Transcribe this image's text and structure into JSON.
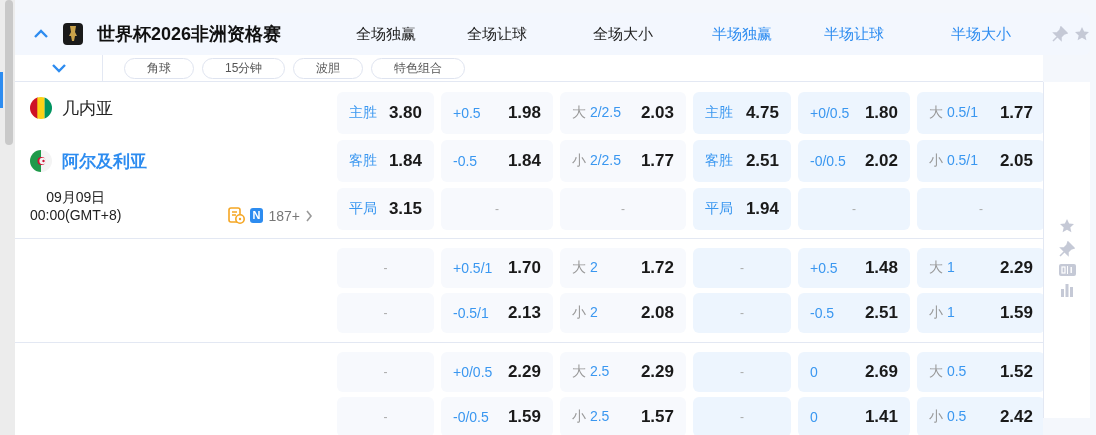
{
  "header": {
    "title": "世界杯2026非洲资格赛",
    "expanded": true,
    "columns": [
      {
        "label": "全场独赢",
        "half": false
      },
      {
        "label": "全场让球",
        "half": false
      },
      {
        "label": "全场大小",
        "half": false
      },
      {
        "label": "半场独赢",
        "half": true
      },
      {
        "label": "半场让球",
        "half": true
      },
      {
        "label": "半场大小",
        "half": true
      }
    ]
  },
  "filter_tabs": [
    "角球",
    "15分钟",
    "波胆",
    "特色组合"
  ],
  "matches": [
    {
      "home": {
        "name": "几内亚",
        "highlighted": false
      },
      "away": {
        "name": "阿尔及利亚",
        "highlighted": true
      },
      "date": "09月09日",
      "time": "00:00(GMT+8)",
      "badge": "N",
      "market_count": "187+",
      "rows": [
        [
          {
            "kind": "result",
            "label": "主胜",
            "odds": "3.80"
          },
          {
            "kind": "handicap",
            "line": "+0.5",
            "odds": "1.98"
          },
          {
            "kind": "total",
            "side": "大",
            "line": "2/2.5",
            "odds": "2.03"
          },
          {
            "kind": "result",
            "label": "主胜",
            "odds": "4.75"
          },
          {
            "kind": "handicap",
            "line": "+0/0.5",
            "odds": "1.80"
          },
          {
            "kind": "total",
            "side": "大",
            "line": "0.5/1",
            "odds": "1.77"
          }
        ],
        [
          {
            "kind": "result",
            "label": "客胜",
            "odds": "1.84"
          },
          {
            "kind": "handicap",
            "line": "-0.5",
            "odds": "1.84"
          },
          {
            "kind": "total",
            "side": "小",
            "line": "2/2.5",
            "odds": "1.77"
          },
          {
            "kind": "result",
            "label": "客胜",
            "odds": "2.51"
          },
          {
            "kind": "handicap",
            "line": "-0/0.5",
            "odds": "2.02"
          },
          {
            "kind": "total",
            "side": "小",
            "line": "0.5/1",
            "odds": "2.05"
          }
        ],
        [
          {
            "kind": "result",
            "label": "平局",
            "odds": "3.15"
          },
          {
            "kind": "empty",
            "text": "-"
          },
          {
            "kind": "empty",
            "text": "-"
          },
          {
            "kind": "result",
            "label": "平局",
            "odds": "1.94"
          },
          {
            "kind": "empty",
            "text": "-"
          },
          {
            "kind": "empty",
            "text": "-"
          }
        ]
      ]
    },
    {
      "rows": [
        [
          {
            "kind": "empty",
            "text": "-"
          },
          {
            "kind": "handicap",
            "line": "+0.5/1",
            "odds": "1.70"
          },
          {
            "kind": "total",
            "side": "大",
            "line": "2",
            "odds": "1.72"
          },
          {
            "kind": "empty",
            "text": "-"
          },
          {
            "kind": "handicap",
            "line": "+0.5",
            "odds": "1.48"
          },
          {
            "kind": "total",
            "side": "大",
            "line": "1",
            "odds": "2.29"
          }
        ],
        [
          {
            "kind": "empty",
            "text": "-"
          },
          {
            "kind": "handicap",
            "line": "-0.5/1",
            "odds": "2.13"
          },
          {
            "kind": "total",
            "side": "小",
            "line": "2",
            "odds": "2.08"
          },
          {
            "kind": "empty",
            "text": "-"
          },
          {
            "kind": "handicap",
            "line": "-0.5",
            "odds": "2.51"
          },
          {
            "kind": "total",
            "side": "小",
            "line": "1",
            "odds": "1.59"
          }
        ]
      ]
    },
    {
      "rows": [
        [
          {
            "kind": "empty",
            "text": "-"
          },
          {
            "kind": "handicap",
            "line": "+0/0.5",
            "odds": "2.29"
          },
          {
            "kind": "total",
            "side": "大",
            "line": "2.5",
            "odds": "2.29"
          },
          {
            "kind": "empty",
            "text": "-"
          },
          {
            "kind": "handicap",
            "line": "0",
            "odds": "2.69"
          },
          {
            "kind": "total",
            "side": "大",
            "line": "0.5",
            "odds": "1.52"
          }
        ],
        [
          {
            "kind": "empty",
            "text": "-"
          },
          {
            "kind": "handicap",
            "line": "-0/0.5",
            "odds": "1.59"
          },
          {
            "kind": "total",
            "side": "小",
            "line": "2.5",
            "odds": "1.57"
          },
          {
            "kind": "empty",
            "text": "-"
          },
          {
            "kind": "handicap",
            "line": "0",
            "odds": "1.41"
          },
          {
            "kind": "total",
            "side": "小",
            "line": "0.5",
            "odds": "2.42"
          }
        ]
      ]
    }
  ]
}
